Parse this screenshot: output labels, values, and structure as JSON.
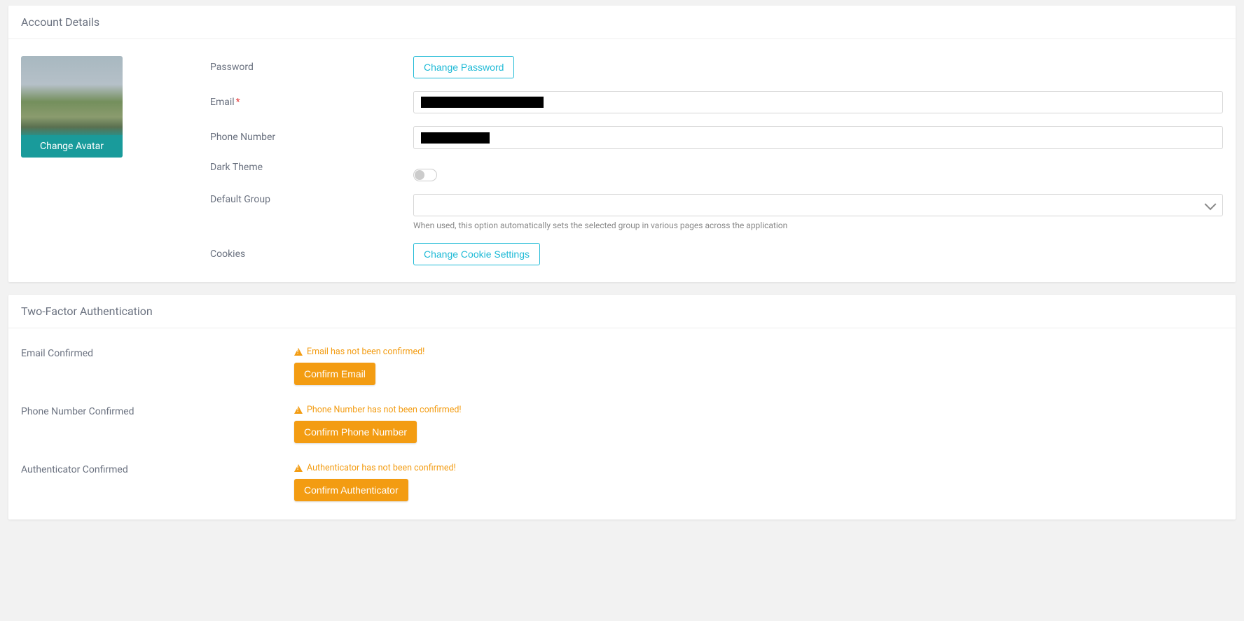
{
  "account": {
    "title": "Account Details",
    "avatar": {
      "change_label": "Change Avatar"
    },
    "password": {
      "label": "Password",
      "button": "Change Password"
    },
    "email": {
      "label": "Email",
      "value": ""
    },
    "phone": {
      "label": "Phone Number",
      "value": ""
    },
    "dark_theme": {
      "label": "Dark Theme"
    },
    "default_group": {
      "label": "Default Group",
      "value": "",
      "help": "When used, this option automatically sets the selected group in various pages across the application"
    },
    "cookies": {
      "label": "Cookies",
      "button": "Change Cookie Settings"
    }
  },
  "tfa": {
    "title": "Two-Factor Authentication",
    "email_confirmed": {
      "label": "Email Confirmed",
      "warning": "Email has not been confirmed!",
      "button": "Confirm Email"
    },
    "phone_confirmed": {
      "label": "Phone Number Confirmed",
      "warning": "Phone Number has not been confirmed!",
      "button": "Confirm Phone Number"
    },
    "authenticator_confirmed": {
      "label": "Authenticator Confirmed",
      "warning": "Authenticator has not been confirmed!",
      "button": "Confirm Authenticator"
    }
  }
}
